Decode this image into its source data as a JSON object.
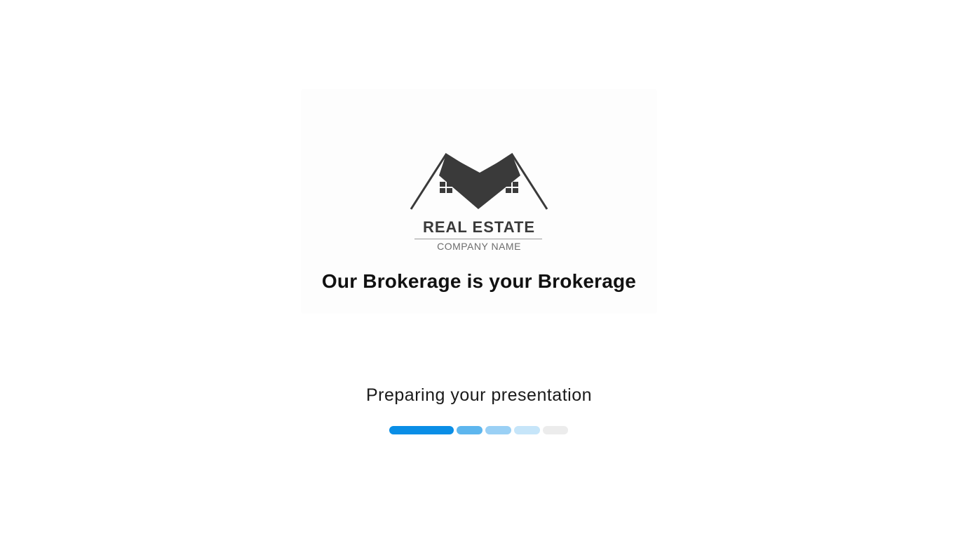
{
  "logo": {
    "title": "REAL ESTATE",
    "subtitle": "COMPANY NAME",
    "icon": "house-roof-icon",
    "color": "#3a3a3a"
  },
  "tagline": "Our Brokerage is your Brokerage",
  "status": {
    "text": "Preparing your presentation"
  },
  "progress": {
    "segments_total": 5,
    "segments_active": 1,
    "colors": [
      "#0a8ee6",
      "#5db6ee",
      "#9ad0f5",
      "#c6e5f9",
      "#ececec"
    ]
  }
}
